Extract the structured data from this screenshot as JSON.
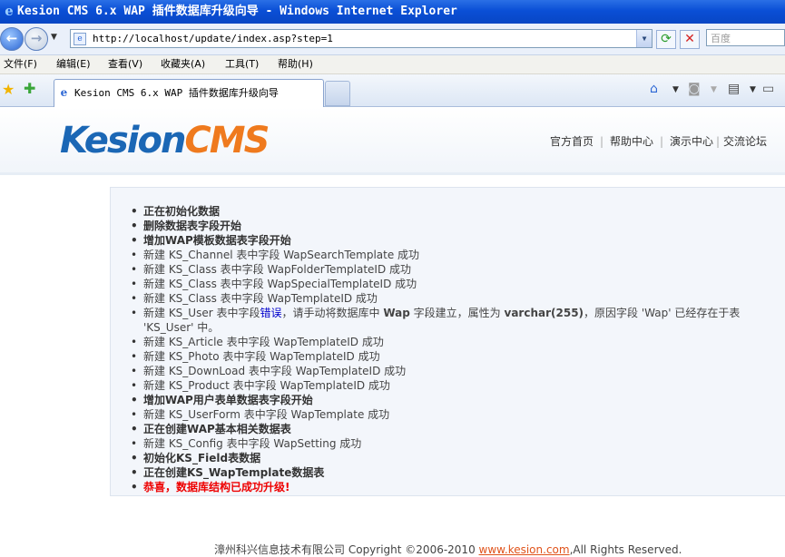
{
  "window": {
    "title": "Kesion CMS 6.x WAP 插件数据库升级向导 - Windows Internet Explorer"
  },
  "browser": {
    "url": "http://localhost/update/index.asp?step=1",
    "search_placeholder": "百度",
    "menu": [
      "文件(F)",
      "编辑(E)",
      "查看(V)",
      "收藏夹(A)",
      "工具(T)",
      "帮助(H)"
    ],
    "tab_title": "Kesion CMS 6.x WAP 插件数据库升级向导"
  },
  "site": {
    "logo_part1": "Kesion",
    "logo_part2": "CMS",
    "nav": [
      "官方首页",
      "帮助中心",
      "演示中心",
      "交流论坛"
    ],
    "nav_separator": "|"
  },
  "log": [
    {
      "text": "正在初始化数据",
      "style": "bold"
    },
    {
      "text": "删除数据表字段开始",
      "style": "bold"
    },
    {
      "text": "增加WAP模板数据表字段开始",
      "style": "bold"
    },
    {
      "text": "新建 KS_Channel 表中字段 WapSearchTemplate 成功",
      "style": "normal"
    },
    {
      "text": "新建 KS_Class 表中字段 WapFolderTemplateID 成功",
      "style": "normal"
    },
    {
      "text": "新建 KS_Class 表中字段 WapSpecialTemplateID 成功",
      "style": "normal"
    },
    {
      "text": "新建 KS_Class 表中字段 WapTemplateID 成功",
      "style": "normal"
    },
    {
      "text": "新建 KS_Article 表中字段 WapTemplateID 成功",
      "style": "normal"
    },
    {
      "text": "新建 KS_Photo 表中字段 WapTemplateID 成功",
      "style": "normal"
    },
    {
      "text": "新建 KS_DownLoad 表中字段 WapTemplateID 成功",
      "style": "normal"
    },
    {
      "text": "新建 KS_Product 表中字段 WapTemplateID 成功",
      "style": "normal"
    },
    {
      "text": "增加WAP用户表单数据表字段开始",
      "style": "bold"
    },
    {
      "text": "新建 KS_UserForm 表中字段 WapTemplate 成功",
      "style": "normal"
    },
    {
      "text": "正在创建WAP基本相关数据表",
      "style": "bold"
    },
    {
      "text": "新建 KS_Config 表中字段 WapSetting 成功",
      "style": "normal"
    },
    {
      "text": "初始化KS_Field表数据",
      "style": "bold"
    },
    {
      "text": "正在创建KS_WapTemplate数据表",
      "style": "bold"
    },
    {
      "text": "恭喜，数据库结构已成功升级!",
      "style": "red"
    }
  ],
  "error_entry": {
    "prefix": "新建 KS_User 表中字段",
    "link": "错误",
    "mid": "，请手动将数据库中",
    "field": "Wap",
    "mid2": "字段建立，属性为",
    "type": "varchar(255)",
    "suffix": "，原因字段 'Wap' 已经存在于表 'KS_User' 中。"
  },
  "footer": {
    "company": "漳州科兴信息技术有限公司",
    "copyright": "Copyright ©2006-2010",
    "link": "www.kesion.com",
    "rights": ",All Rights Reserved."
  }
}
